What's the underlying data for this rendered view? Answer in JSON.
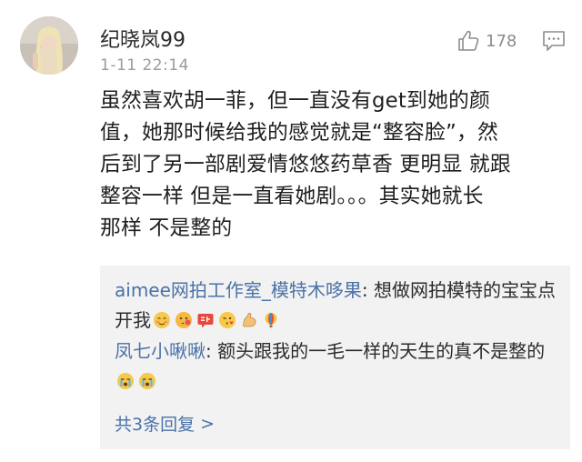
{
  "comment": {
    "username": "纪晓岚99",
    "timestamp": "1-11 22:14",
    "like_count": "178",
    "body": "虽然喜欢胡一菲，但一直没有get到她的颜\n值，她那时候给我的感觉就是“整容脸”，然\n后到了另一部剧爱情悠悠药草香 更明显 就跟\n整容一样 但是一直看她剧。。。其实她就长\n那样 不是整的"
  },
  "replies": [
    {
      "author": "aimee网拍工作室_模特木哆果",
      "separator": ": ",
      "text": "想做网拍模特的宝宝点开我",
      "emojis": [
        "blush-emoji",
        "cheek-kiss-emoji",
        "encourage-emoji",
        "kiss-emoji",
        "muscle-emoji",
        "balloon-emoji"
      ]
    },
    {
      "author": "凤七小啾啾",
      "separator": ": ",
      "text": "额头跟我的一毛一样的天生的真不是整的",
      "emojis": [
        "crying-emoji",
        "crying-emoji"
      ]
    }
  ],
  "more_replies": {
    "label": "共3条回复",
    "chevron": ">"
  },
  "colors": {
    "link_blue": "#4a72a8",
    "meta_gray": "#9b9b9b",
    "reply_bg": "#f2f2f2"
  },
  "icons": {
    "like": "thumbs-up-icon",
    "reply": "comment-bubble-icon"
  }
}
